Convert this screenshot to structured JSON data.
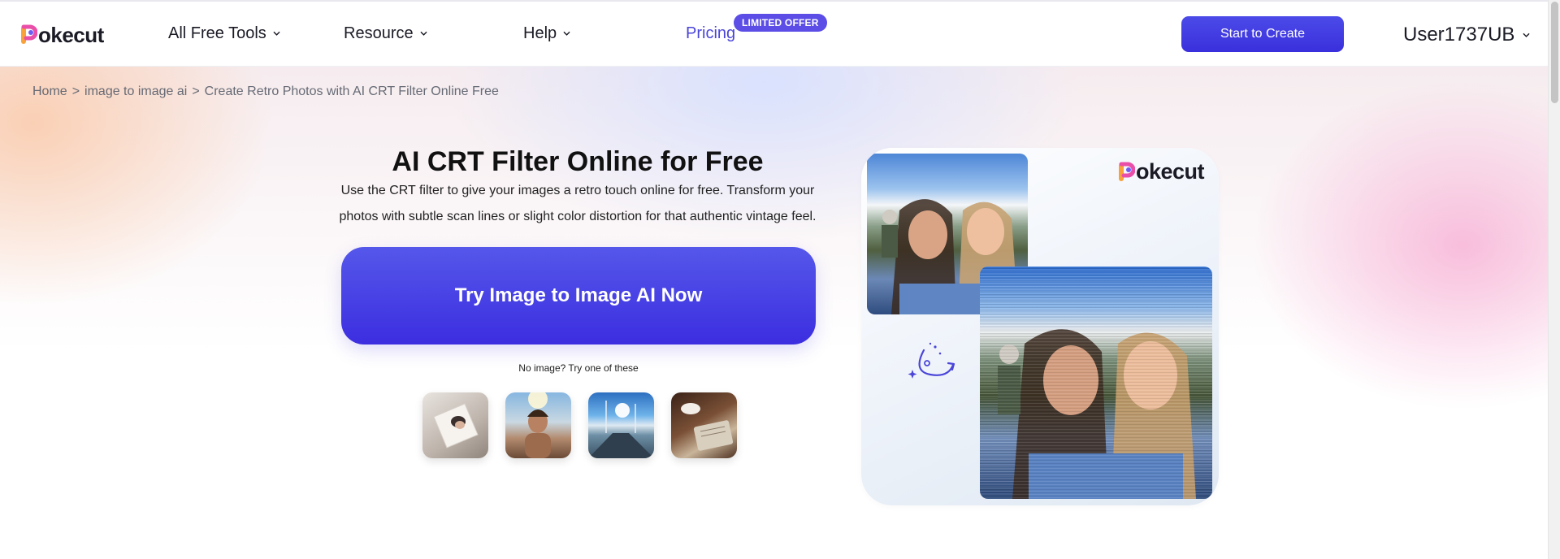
{
  "brand": {
    "name": "okecut",
    "accent": "#4a45d8",
    "logo_colors": [
      "#f9a13b",
      "#e94fa8",
      "#6e5cf2"
    ]
  },
  "nav": {
    "items": [
      {
        "label": "All Free Tools",
        "has_dropdown": true
      },
      {
        "label": "Resource",
        "has_dropdown": true
      },
      {
        "label": "Help",
        "has_dropdown": true
      }
    ],
    "pricing_label": "Pricing",
    "pricing_badge": "LIMITED OFFER",
    "start_button": "Start to Create",
    "user": "User1737UB"
  },
  "breadcrumb": {
    "items": [
      "Home",
      "image to image ai",
      "Create Retro Photos with AI CRT Filter Online Free"
    ],
    "separator": ">"
  },
  "hero": {
    "title": "AI CRT Filter Online for Free",
    "description": "Use the CRT filter to give your images a retro touch online for free. Transform your photos with subtle scan lines or slight color distortion for that authentic vintage feel.",
    "cta": "Try Image to Image AI Now",
    "no_image_text": "No image? Try one of these",
    "samples": [
      "sample-photo-notebook",
      "sample-photo-man-sunlight",
      "sample-photo-harbor",
      "sample-photo-coffee-book"
    ]
  },
  "preview": {
    "logo": "okecut"
  }
}
